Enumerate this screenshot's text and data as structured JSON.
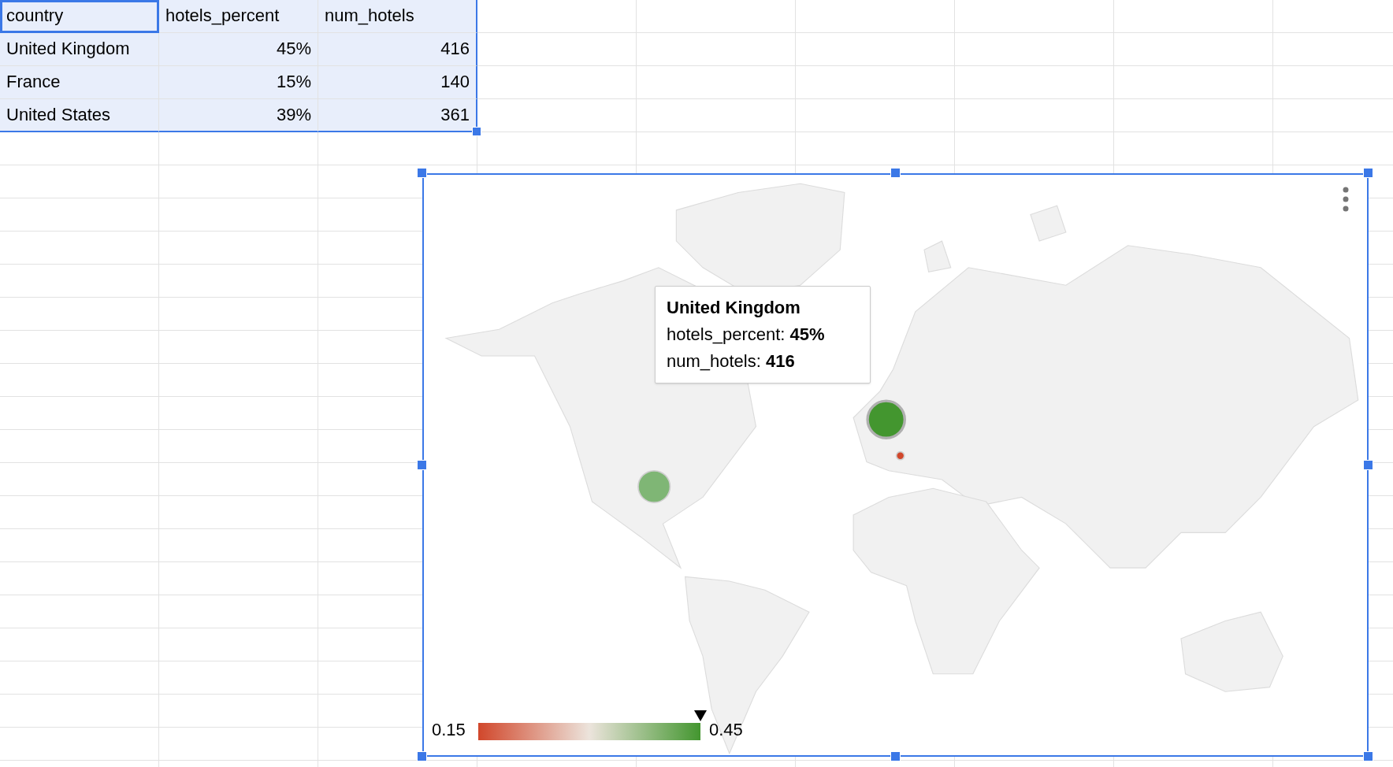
{
  "sheet": {
    "columns": [
      {
        "label": "country",
        "selected": true
      },
      {
        "label": "hotels_percent",
        "selected": false
      },
      {
        "label": "num_hotels",
        "selected": false
      }
    ],
    "rows": [
      [
        "United Kingdom",
        "45%",
        "416"
      ],
      [
        "France",
        "15%",
        "140"
      ],
      [
        "United States",
        "39%",
        "361"
      ]
    ]
  },
  "chart": {
    "tooltip": {
      "title": "United Kingdom",
      "lines": [
        "hotels_percent: **45%**",
        "num_hotels: **416**"
      ]
    },
    "bubbles": [
      {
        "color": "#43962f"
      },
      {
        "color": "#d1472b"
      },
      {
        "color": "#7fb675"
      }
    ],
    "legend": {
      "min": "0.15",
      "max": "0.45",
      "level": 1
    }
  }
}
